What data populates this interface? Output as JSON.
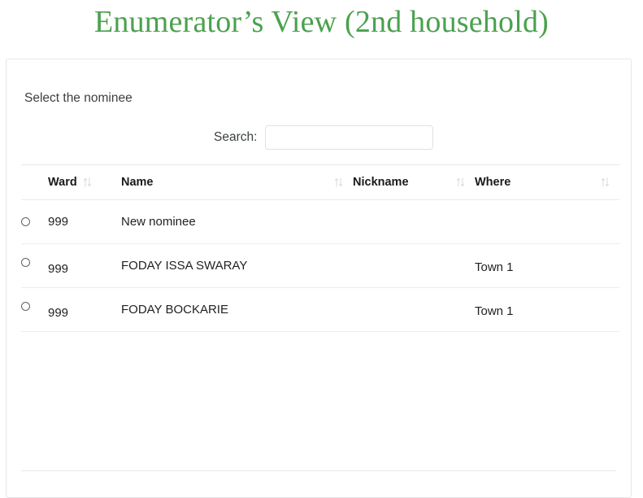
{
  "slide": {
    "title": "Enumerator’s View (2nd household)",
    "title_color": "#4aa14e"
  },
  "panel": {
    "label": "Select the nominee"
  },
  "search": {
    "label": "Search:",
    "value": "",
    "placeholder": ""
  },
  "table": {
    "columns": [
      {
        "key": "radio",
        "label": "",
        "sortable": false
      },
      {
        "key": "ward",
        "label": "Ward",
        "sortable": true
      },
      {
        "key": "name",
        "label": "Name",
        "sortable": true
      },
      {
        "key": "nickname",
        "label": "Nickname",
        "sortable": true
      },
      {
        "key": "where",
        "label": "Where",
        "sortable": true
      }
    ],
    "sort_icon": "sort-updown-icon",
    "rows": [
      {
        "selected": false,
        "ward": "999",
        "name": "New nominee",
        "nickname": "",
        "where": ""
      },
      {
        "selected": false,
        "ward": "999",
        "name": "FODAY ISSA SWARAY",
        "nickname": "",
        "where": "Town 1"
      },
      {
        "selected": false,
        "ward": "999",
        "name": "FODAY BOCKARIE",
        "nickname": "",
        "where": "Town 1"
      }
    ]
  }
}
